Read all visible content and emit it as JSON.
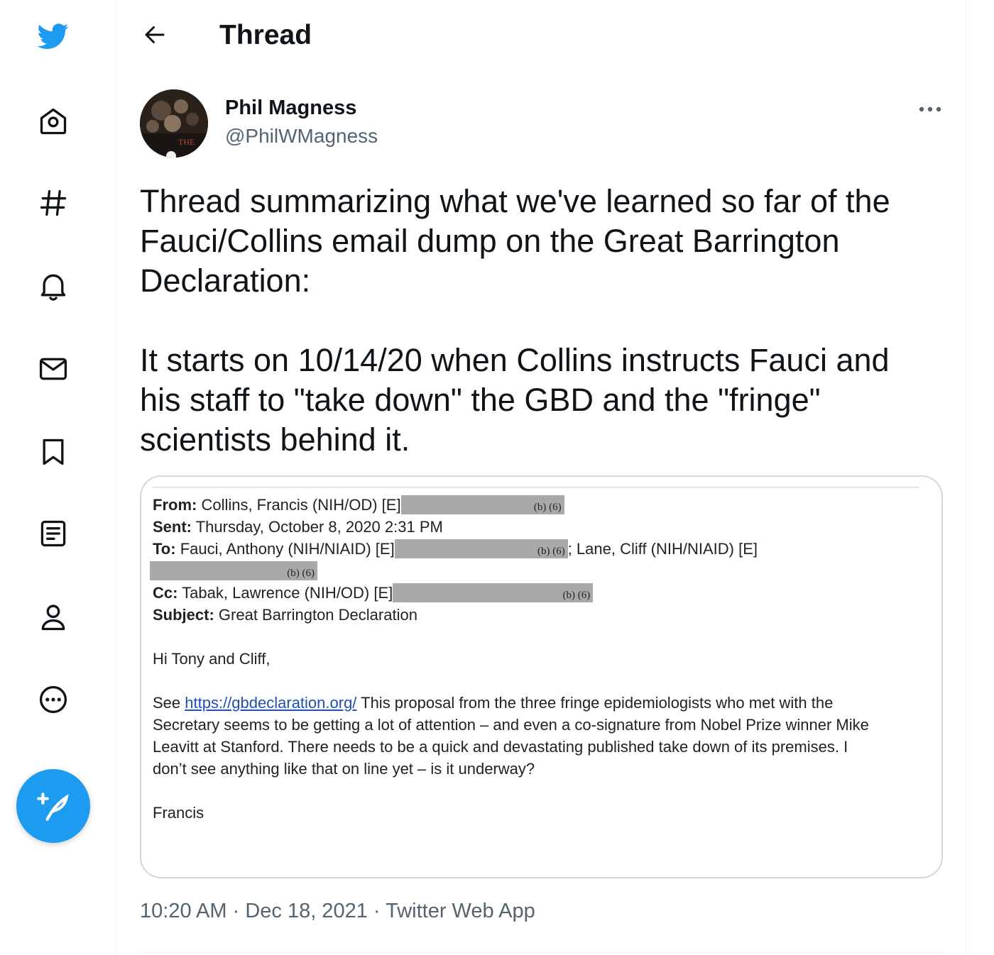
{
  "colors": {
    "accent": "#1d9bf0",
    "text": "#0f1419",
    "muted": "#536471",
    "border": "#cfd9de"
  },
  "sidebar": {
    "items": [
      {
        "icon": "twitter-bird-icon"
      },
      {
        "icon": "home-icon"
      },
      {
        "icon": "hashtag-icon"
      },
      {
        "icon": "bell-icon"
      },
      {
        "icon": "mail-icon"
      },
      {
        "icon": "bookmark-icon"
      },
      {
        "icon": "lists-icon"
      },
      {
        "icon": "profile-icon"
      },
      {
        "icon": "more-circle-icon"
      },
      {
        "icon": "compose-tweet-icon"
      }
    ]
  },
  "header": {
    "title": "Thread"
  },
  "tweet": {
    "author_name": "Phil Magness",
    "author_handle": "@PhilWMagness",
    "avatar_text": "THE",
    "text_paragraph_1": "Thread summarizing what we've learned so far of the Fauci/Collins email dump on the Great Barrington Declaration:",
    "text_paragraph_2": "It starts on 10/14/20 when Collins instructs Fauci and his staff to \"take down\" the GBD and the \"fringe\" scientists behind it.",
    "time": "10:20 AM",
    "date": "Dec 18, 2021",
    "source": "Twitter Web App",
    "separator": " · "
  },
  "email_image": {
    "from_label": "From:",
    "from_value": " Collins, Francis (NIH/OD) [E]",
    "redaction_code": "(b) (6)",
    "sent_label": "Sent:",
    "sent_value": " Thursday, October 8, 2020 2:31 PM",
    "to_label": "To:",
    "to_value": " Fauci, Anthony (NIH/NIAID) [E]",
    "to_value_2": "; Lane, Cliff (NIH/NIAID) [E]",
    "cc_label": "Cc:",
    "cc_value": " Tabak, Lawrence (NIH/OD) [E]",
    "subject_label": "Subject:",
    "subject_value": " Great Barrington Declaration",
    "greeting": "Hi Tony and Cliff,",
    "body_prefix": "See ",
    "body_link": "https://gbdeclaration.org/",
    "body_line_1": "  This proposal from the three fringe epidemiologists who met with the",
    "body_line_2": "Secretary seems to be getting a lot of attention – and even a co-signature from Nobel Prize winner Mike",
    "body_line_3": "Leavitt at Stanford.  There needs to be a quick and devastating published take down of its premises.  I",
    "body_line_4": "don’t see anything like that on line yet – is it underway?",
    "signature": "Francis"
  }
}
